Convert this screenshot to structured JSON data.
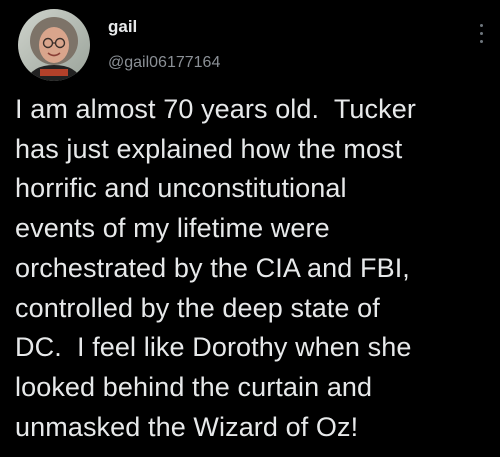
{
  "author": {
    "display_name": "gail",
    "handle": "@gail06177164",
    "avatar_icon": "user-avatar-photo"
  },
  "menu": {
    "icon": "more-options-icon"
  },
  "tweet": {
    "lines": [
      "I am almost 70 years old.  Tucker",
      "has just explained how the most",
      "horrific and unconstitutional",
      "events of my lifetime were",
      "orchestrated by the CIA and FBI,",
      "controlled by the deep state of",
      "DC.  I feel like Dorothy when she",
      "looked behind the curtain and",
      "unmasked the Wizard of Oz!"
    ]
  },
  "colors": {
    "background": "#000000",
    "text": "#e7e9ea",
    "secondary_text": "#8b9096"
  }
}
